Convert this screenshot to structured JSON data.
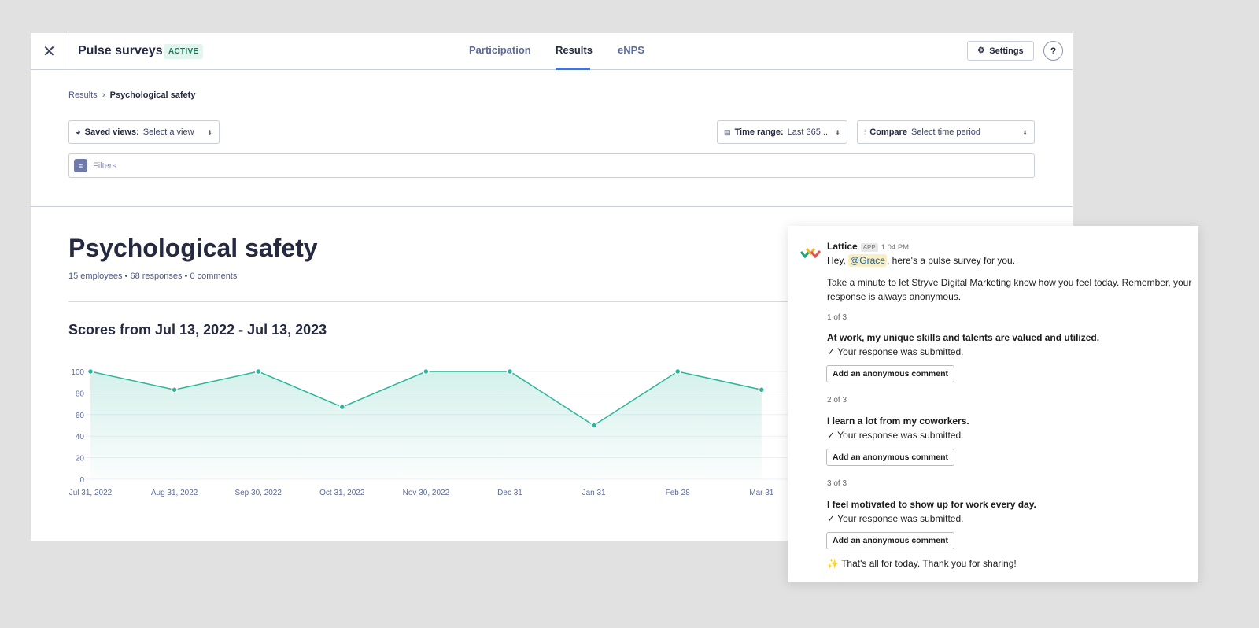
{
  "header": {
    "close_icon": "close-icon",
    "title": "Pulse surveys",
    "badge": "ACTIVE",
    "tabs": [
      {
        "label": "Participation"
      },
      {
        "label": "Results",
        "active": true
      },
      {
        "label": "eNPS"
      }
    ],
    "settings_label": "Settings",
    "help_label": "?"
  },
  "breadcrumb": {
    "parent": "Results",
    "separator": "›",
    "current": "Psychological safety"
  },
  "filters": {
    "saved_views_label": "Saved views:",
    "saved_views_value": "Select a view",
    "time_range_label": "Time range:",
    "time_range_value": "Last 365 ...",
    "compare_label": "Compare",
    "compare_value": "Select time period",
    "filters_placeholder": "Filters"
  },
  "page": {
    "title": "Psychological safety",
    "meta": "15 employees • 68 responses • 0 comments",
    "chart_heading": "Scores from Jul 13, 2022 - Jul 13, 2023"
  },
  "chart_data": {
    "type": "area",
    "x": [
      "Jul 31, 2022",
      "Aug 31, 2022",
      "Sep 30, 2022",
      "Oct 31, 2022",
      "Nov 30, 2022",
      "Dec 31",
      "Jan 31",
      "Feb 28",
      "Mar 31"
    ],
    "values": [
      100,
      83,
      100,
      67,
      100,
      100,
      50,
      100,
      83
    ],
    "yticks": [
      0,
      20,
      40,
      60,
      80,
      100
    ],
    "ylim": [
      0,
      100
    ],
    "grid": true,
    "color": "#2bb59a"
  },
  "slack": {
    "sender": "Lattice",
    "app_badge": "APP",
    "time": "1:04 PM",
    "greeting_pre": "Hey, ",
    "mention": "@Grace",
    "greeting_post": ", here's a pulse survey for you.",
    "intro1": "Take a minute to let Stryve Digital Marketing know how you feel today. Remember, your",
    "intro2": "response is always anonymous.",
    "questions": [
      {
        "counter": "1 of 3",
        "text": "At work, my unique skills and talents are valued and utilized.",
        "status": "✓ Your response was submitted.",
        "button": "Add an anonymous comment"
      },
      {
        "counter": "2 of 3",
        "text": "I learn a lot from my coworkers.",
        "status": "✓ Your response was submitted.",
        "button": "Add an anonymous comment"
      },
      {
        "counter": "3 of 3",
        "text": "I feel motivated to show up for work every day.",
        "status": "✓ Your response was submitted.",
        "button": "Add an anonymous comment"
      }
    ],
    "closing_emoji": "✨",
    "closing": "That's all for today. Thank you for sharing!"
  }
}
